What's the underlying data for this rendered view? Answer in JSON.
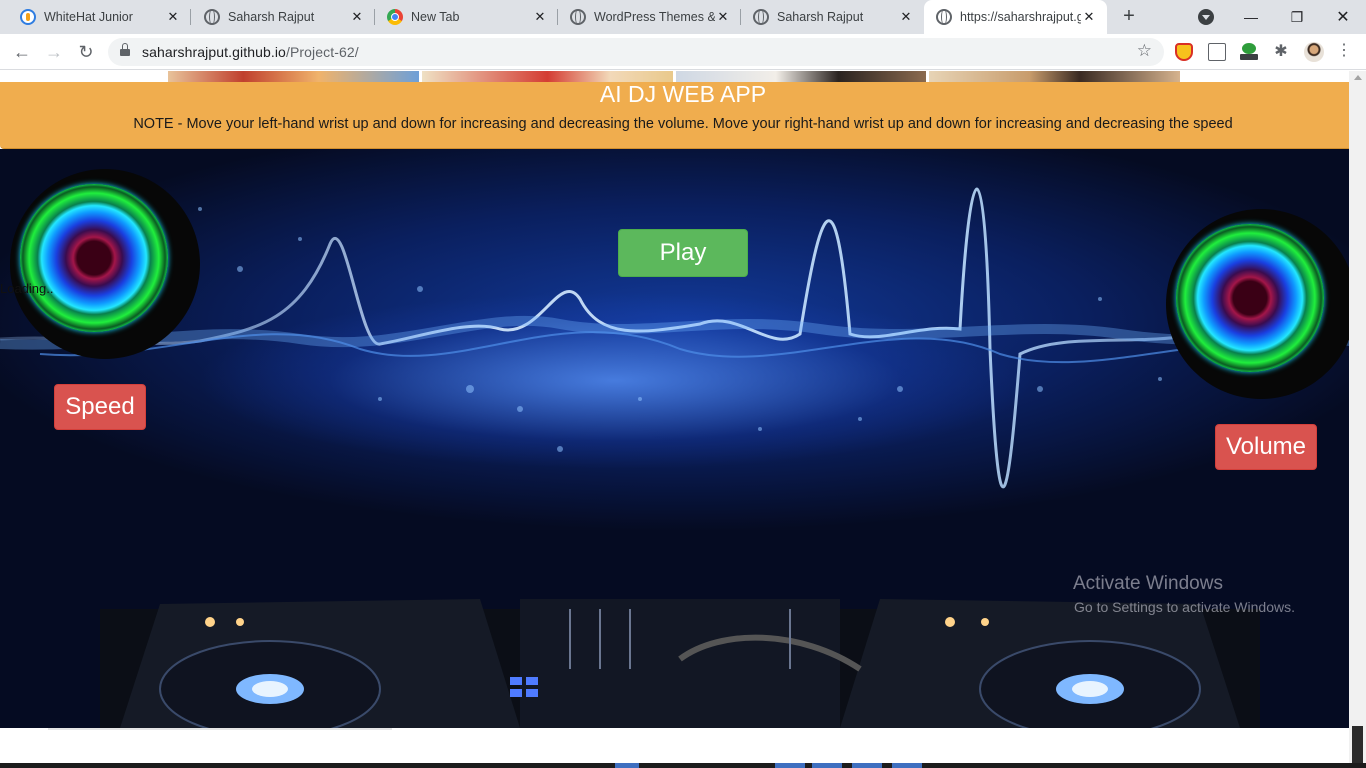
{
  "browser": {
    "tabs": [
      {
        "title": "WhiteHat Junior",
        "icon": "whitehat-icon",
        "active": false
      },
      {
        "title": "Saharsh Rajput",
        "icon": "globe-icon",
        "active": false
      },
      {
        "title": "New Tab",
        "icon": "chrome-icon",
        "active": false
      },
      {
        "title": "WordPress Themes &",
        "icon": "globe-icon",
        "active": false
      },
      {
        "title": "Saharsh Rajput",
        "icon": "globe-icon",
        "active": false
      },
      {
        "title": "https://saharshrajput.g",
        "icon": "globe-icon",
        "active": true
      }
    ],
    "close_glyph": "✕",
    "new_tab_glyph": "+",
    "url_host": "saharshrajput.github.io",
    "url_path": "/Project-62/",
    "nav": {
      "back": "←",
      "forward": "→",
      "reload": "↻"
    },
    "window": {
      "minimize": "—",
      "maximize": "❐",
      "close": "✕"
    }
  },
  "page": {
    "title": "AI DJ WEB APP",
    "note": "NOTE - Move your left-hand wrist up and down for increasing and decreasing the volume. Move your right-hand wrist up and down for increasing and decreasing the speed",
    "play_label": "Play",
    "speed_label": "Speed",
    "volume_label": "Volume",
    "loading_text": "Loading..",
    "colors": {
      "header": "#f0ad4e",
      "play": "#5cb85c",
      "danger": "#d9534f"
    }
  },
  "watermark": {
    "line1": "Activate Windows",
    "line2": "Go to Settings to activate Windows."
  }
}
